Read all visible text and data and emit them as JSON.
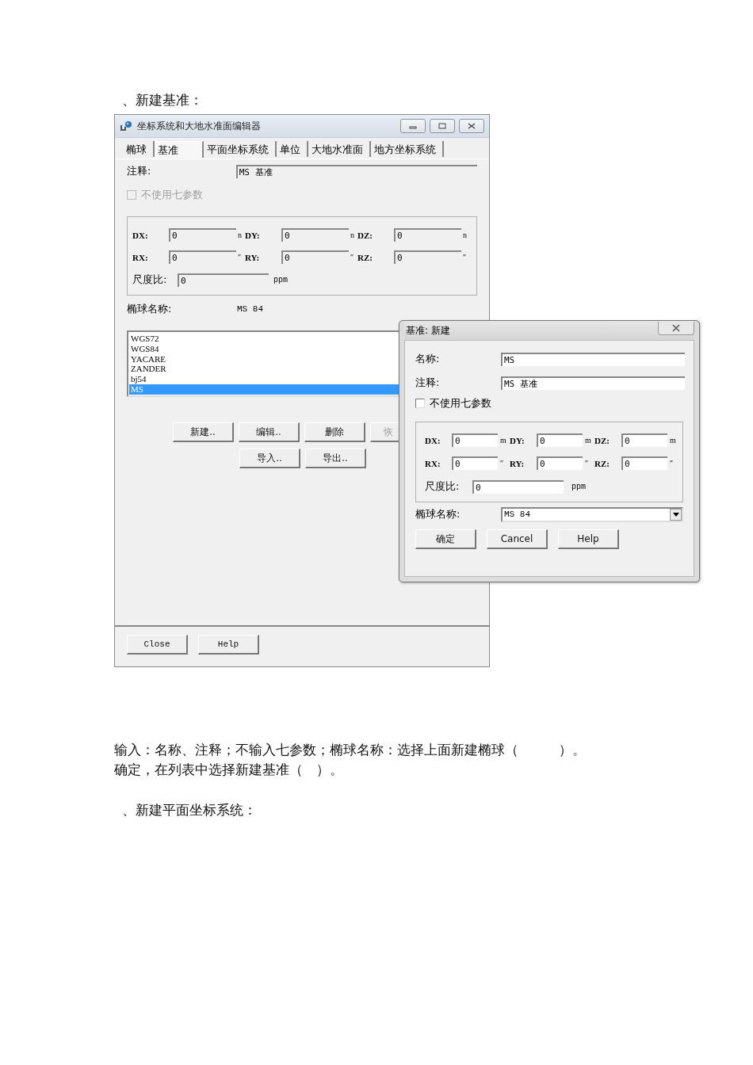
{
  "heading_1": "、新建基准：",
  "editor": {
    "title": "坐标系统和大地水准面编辑器",
    "tabs": [
      {
        "label": "椭球",
        "selected": false
      },
      {
        "label": "基准",
        "selected": true
      },
      {
        "label": "平面坐标系统",
        "selected": false
      },
      {
        "label": "单位",
        "selected": false
      },
      {
        "label": "大地水准面",
        "selected": false
      },
      {
        "label": "地方坐标系统",
        "selected": false
      }
    ],
    "comment": {
      "label": "注释:",
      "value": "MS 基准"
    },
    "seven_params": {
      "label": "不使用七参数",
      "checked": false,
      "disabled": true
    },
    "params": [
      {
        "label": "DX:",
        "value": "0",
        "unit": "n"
      },
      {
        "label": "DY:",
        "value": "0",
        "unit": "n"
      },
      {
        "label": "DZ:",
        "value": "0",
        "unit": "n"
      },
      {
        "label": "RX:",
        "value": "0",
        "unit": "″"
      },
      {
        "label": "RY:",
        "value": "0",
        "unit": "″"
      },
      {
        "label": "RZ:",
        "value": "0",
        "unit": "″"
      }
    ],
    "scale": {
      "label": "尺度比:",
      "value": "0",
      "unit": "ppm"
    },
    "ellipsoid": {
      "label": "椭球名称:",
      "value": "MS 84"
    },
    "datums": [
      {
        "name": "WGS72",
        "selected": false
      },
      {
        "name": "WGS84",
        "selected": false
      },
      {
        "name": "YACARE",
        "selected": false
      },
      {
        "name": "ZANDER",
        "selected": false
      },
      {
        "name": "bj54",
        "selected": false
      },
      {
        "name": "MS",
        "selected": true
      }
    ],
    "buttons": [
      {
        "label": "新建..",
        "disabled": false
      },
      {
        "label": "编辑..",
        "disabled": false
      },
      {
        "label": "删除",
        "disabled": false
      },
      {
        "label": "恢",
        "disabled": true
      },
      {
        "label": "导入..",
        "disabled": false
      },
      {
        "label": "导出..",
        "disabled": false
      }
    ],
    "footer_buttons": [
      "Close",
      "Help"
    ]
  },
  "new_dialog": {
    "title": "基准: 新建",
    "name": {
      "label": "名称:",
      "value": "MS"
    },
    "comment": {
      "label": "注释:",
      "value": "MS 基准"
    },
    "seven_params": {
      "label": "不使用七参数",
      "checked": false,
      "disabled": false
    },
    "params": [
      {
        "label": "DX:",
        "value": "0",
        "unit": "m"
      },
      {
        "label": "DY:",
        "value": "0",
        "unit": "m"
      },
      {
        "label": "DZ:",
        "value": "0",
        "unit": "m"
      },
      {
        "label": "RX:",
        "value": "0",
        "unit": "″"
      },
      {
        "label": "RY:",
        "value": "0",
        "unit": "″"
      },
      {
        "label": "RZ:",
        "value": "0",
        "unit": "″"
      }
    ],
    "scale": {
      "label": "尺度比:",
      "value": "0",
      "unit": "ppm"
    },
    "ellipsoid": {
      "label": "椭球名称:",
      "value": "MS 84"
    },
    "buttons": [
      "确定",
      "Cancel",
      "Help"
    ]
  },
  "paragraphs": [
    "输入：名称、注释；不输入七参数；椭球名称：选择上面新建椭球（　　　）。",
    "确定，在列表中选择新建基准（　）。"
  ],
  "heading_2": "、新建平面坐标系统："
}
